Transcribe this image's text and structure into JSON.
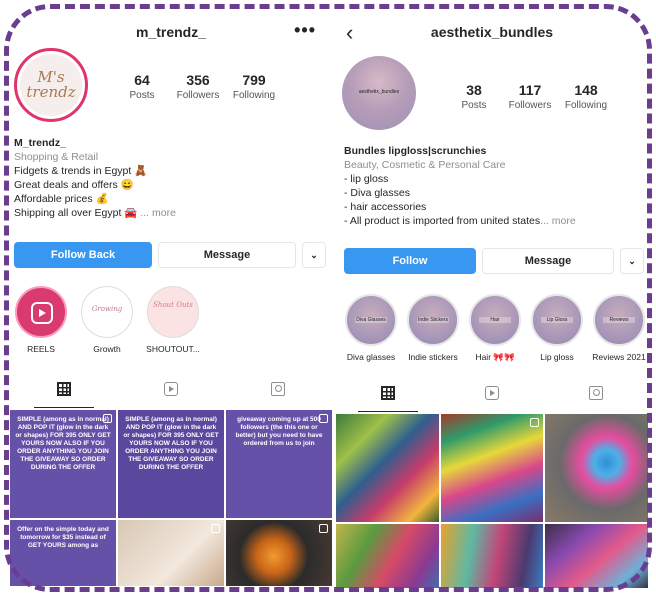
{
  "left_profile": {
    "username": "m_trendz_",
    "menu_glyph": "•••",
    "avatar_logo": [
      "M's",
      "trendz"
    ],
    "stats": [
      {
        "num": "64",
        "label": "Posts"
      },
      {
        "num": "356",
        "label": "Followers"
      },
      {
        "num": "799",
        "label": "Following"
      }
    ],
    "bio": {
      "name": "M_trendz_",
      "category": "Shopping & Retail",
      "lines": [
        "Fidgets & trends in Egypt 🧸",
        "Great deals and offers 😄",
        "Affordable prices 💰"
      ],
      "last_line": "Shipping all over Egypt 🚘",
      "more": "... more"
    },
    "buttons": {
      "primary": "Follow Back",
      "secondary": "Message",
      "dropdown": "⌄"
    },
    "highlights": [
      {
        "label": "REELS",
        "style": "reels",
        "inner": ""
      },
      {
        "label": "Growth",
        "style": "blank",
        "inner": "Growing"
      },
      {
        "label": "SHOUTOUT...",
        "style": "pink",
        "inner": "Shout Outs"
      }
    ],
    "posts": [
      "SIMPLE (among as in normal) AND POP IT (glow in the dark or shapes) FOR 395 ONLY GET YOURS NOW ALSO IF YOU ORDER ANYTHING YOU JOIN THE GIVEAWAY SO ORDER DURING THE OFFER",
      "SIMPLE (among as in normal) AND POP IT (glow in the dark or shapes) FOR 395 ONLY GET YOURS NOW ALSO IF YOU ORDER ANYTHING YOU JOIN THE GIVEAWAY SO ORDER DURING THE OFFER",
      "giveaway coming up at 500 followers (the this one or better) but you need to have ordered from us to join",
      "Offer on the simple today and tomorrow for $35 instead of GET YOURS among as",
      "",
      ""
    ]
  },
  "right_profile": {
    "username": "aesthetix_bundles",
    "back_glyph": "‹",
    "avatar_tag": "aesthetix_bundles",
    "stats": [
      {
        "num": "38",
        "label": "Posts"
      },
      {
        "num": "117",
        "label": "Followers"
      },
      {
        "num": "148",
        "label": "Following"
      }
    ],
    "bio": {
      "name": "Bundles lipgloss|scrunchies",
      "category": "Beauty, Cosmetic & Personal Care",
      "lines": [
        "- lip gloss",
        "- Diva glasses",
        "- hair accessories"
      ],
      "last_line": "- All product is imported from united states",
      "more": "... more"
    },
    "buttons": {
      "primary": "Follow",
      "secondary": "Message",
      "dropdown": "⌄"
    },
    "highlights": [
      {
        "label": "Diva glasses",
        "tag": "Diva Glasses"
      },
      {
        "label": "Indie stickers",
        "tag": "Indie Stickers"
      },
      {
        "label": "Hair 🎀🎀",
        "tag": "Hair"
      },
      {
        "label": "Lip gloss",
        "tag": "Lip Gloss"
      },
      {
        "label": "Reviews 2021",
        "tag": "Reviews"
      }
    ]
  },
  "colors": {
    "frame": "#6a3d8f",
    "primary_button": "#3897f0",
    "post_purple": "#6651a8"
  },
  "icons": [
    "more-dots-icon",
    "back-arrow-icon",
    "grid-icon",
    "reels-tab-icon",
    "tagged-icon",
    "reels-play-icon"
  ]
}
